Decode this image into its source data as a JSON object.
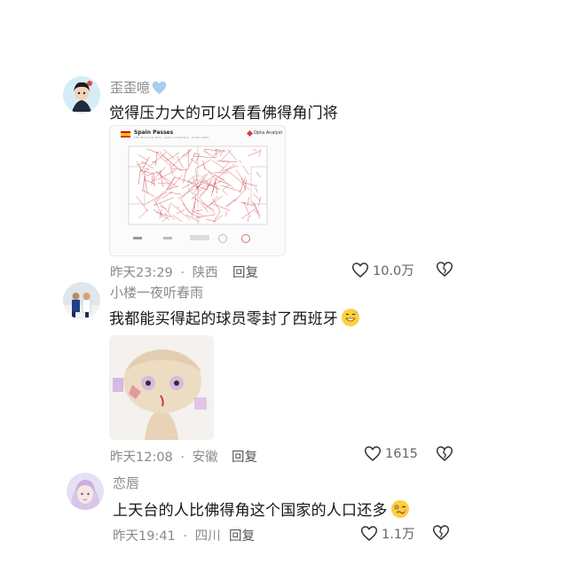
{
  "comments": [
    {
      "username": "歪歪噫",
      "text": "觉得压力大的可以看看佛得角门将",
      "time": "昨天23:29",
      "location": "陕西",
      "reply_label": "回复",
      "likes": "10.0万",
      "image": {
        "title": "Spain Passes",
        "subtitle": "FIFA World Cup 2022 · Spain v Costa Rica · 23 Nov 2022",
        "brand": "Opta Analyst"
      }
    },
    {
      "username": "小楼一夜听春雨",
      "text": "我都能买得起的球员零封了西班牙",
      "time": "昨天12:08",
      "location": "安徽",
      "reply_label": "回复",
      "likes": "1615"
    },
    {
      "username": "恋唇",
      "text": "上天台的人比佛得角这个国家的人口还多",
      "time": "昨天19:41",
      "location": "四川",
      "reply_label": "回复",
      "likes": "1.1万"
    }
  ],
  "separator": "·",
  "colors": {
    "heart_badge": "#a8cdee",
    "pass_lines": "#c8202e",
    "muted_text": "#8a8a8a"
  },
  "icons": [
    "heart-outline-icon",
    "heart-broken-icon",
    "blue-heart-emoji",
    "grin-sweat-emoji",
    "woozy-face-emoji"
  ]
}
